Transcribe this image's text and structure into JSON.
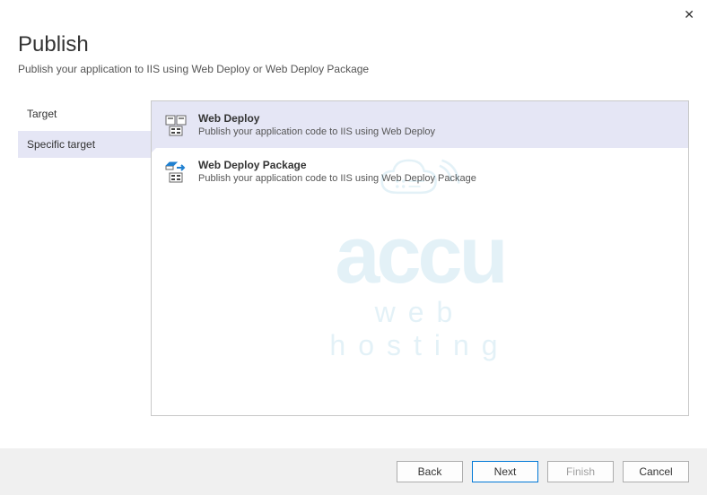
{
  "header": {
    "title": "Publish",
    "subtitle": "Publish your application to IIS using Web Deploy or Web Deploy Package"
  },
  "close_label": "✕",
  "sidebar": {
    "items": [
      {
        "label": "Target"
      },
      {
        "label": "Specific target"
      }
    ]
  },
  "options": [
    {
      "title": "Web Deploy",
      "desc": "Publish your application code to IIS using Web Deploy"
    },
    {
      "title": "Web Deploy Package",
      "desc": "Publish your application code to IIS using Web Deploy Package"
    }
  ],
  "buttons": {
    "back": "Back",
    "next": "Next",
    "finish": "Finish",
    "cancel": "Cancel"
  },
  "watermark": {
    "main": "accu",
    "sub": "web hosting"
  }
}
